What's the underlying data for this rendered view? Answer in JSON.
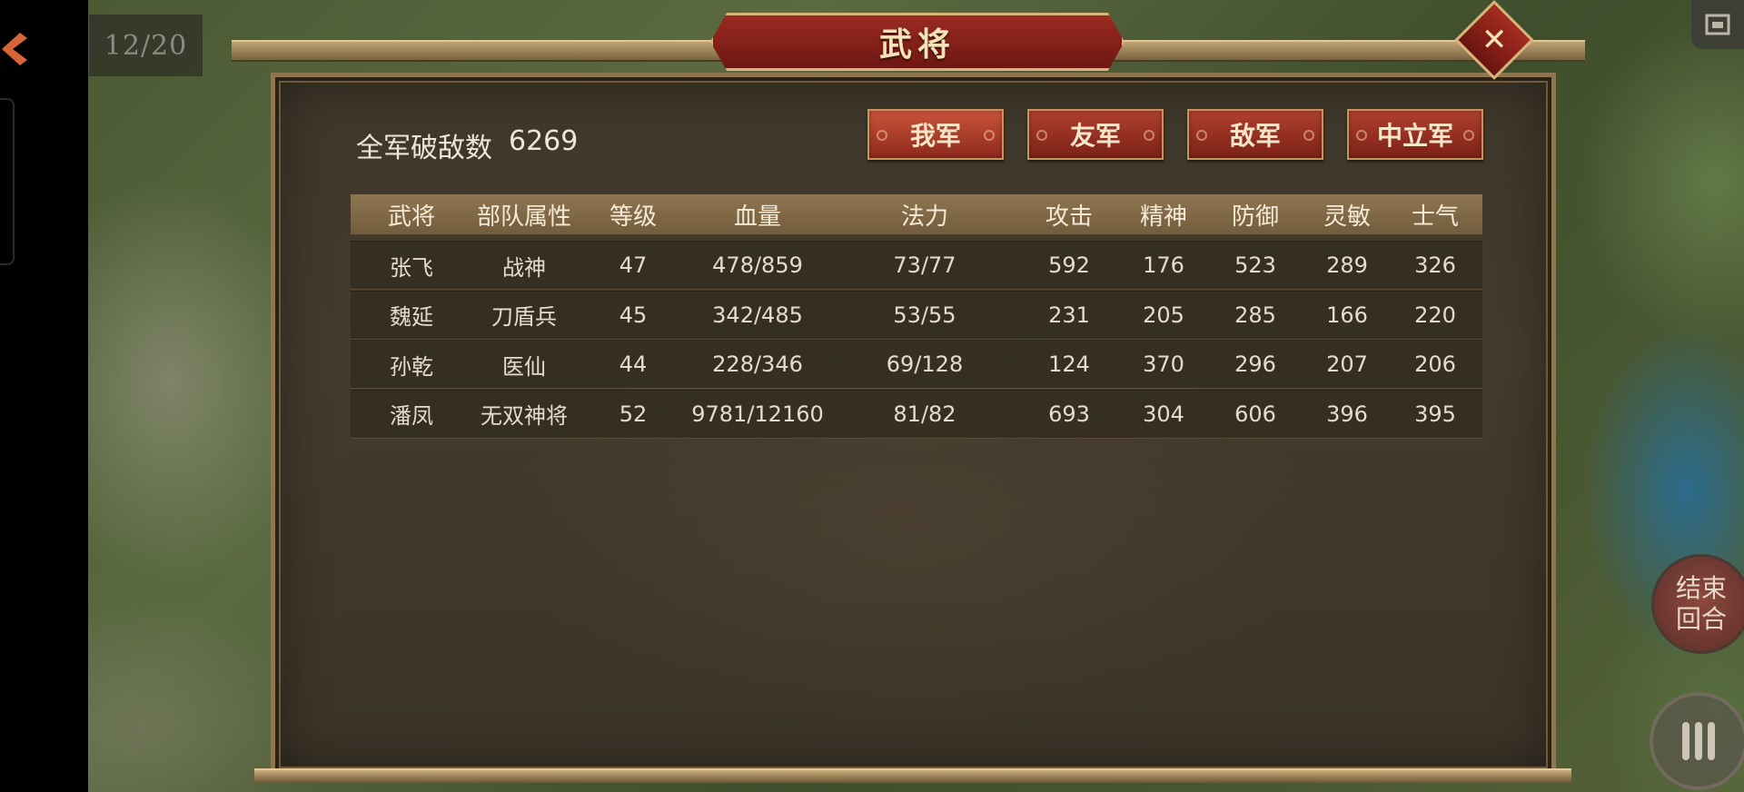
{
  "hud": {
    "turn_counter": "12/20",
    "end_turn_label": "结束\n回合",
    "end_turn_line1": "结束",
    "end_turn_line2": "回合"
  },
  "dialog": {
    "title": "武将",
    "close_label": "✕",
    "kill_count_label": "全军破敌数",
    "kill_count_value": "6269",
    "faction_tabs": [
      {
        "label": "我军",
        "active": true
      },
      {
        "label": "友军",
        "active": false
      },
      {
        "label": "敌军",
        "active": false
      },
      {
        "label": "中立军",
        "active": false
      }
    ],
    "table": {
      "headers": [
        "武将",
        "部队属性",
        "等级",
        "血量",
        "法力",
        "攻击",
        "精神",
        "防御",
        "灵敏",
        "士气"
      ],
      "rows": [
        [
          "张飞",
          "战神",
          "47",
          "478/859",
          "73/77",
          "592",
          "176",
          "523",
          "289",
          "326"
        ],
        [
          "魏延",
          "刀盾兵",
          "45",
          "342/485",
          "53/55",
          "231",
          "205",
          "285",
          "166",
          "220"
        ],
        [
          "孙乾",
          "医仙",
          "44",
          "228/346",
          "69/128",
          "124",
          "370",
          "296",
          "207",
          "206"
        ],
        [
          "潘凤",
          "无双神将",
          "52",
          "9781/12160",
          "81/82",
          "693",
          "304",
          "606",
          "396",
          "395"
        ]
      ]
    }
  },
  "colors": {
    "panel_bg": "#3e372b",
    "gold_trim": "#bfa373",
    "button_red": "#b0402e",
    "header_tan": "#8f7652",
    "text_light": "#efe6d4"
  },
  "icons": [
    "back-logo-icon",
    "close-icon",
    "window-icon",
    "menu-icon"
  ]
}
